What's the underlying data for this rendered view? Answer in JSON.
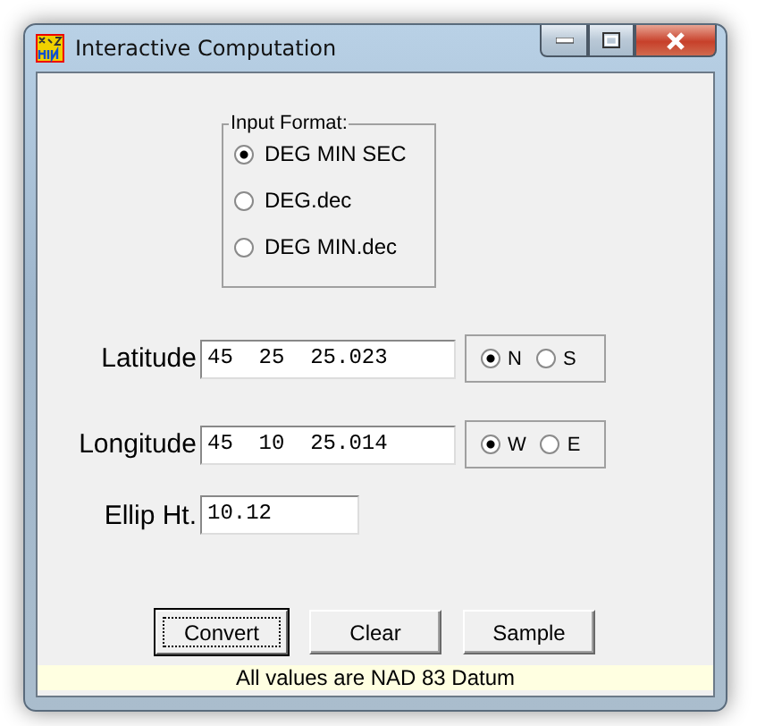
{
  "window": {
    "title": "Interactive Computation"
  },
  "input_format": {
    "label": "Input Format:",
    "options": [
      {
        "label": "DEG MIN SEC",
        "selected": true
      },
      {
        "label": "DEG.dec",
        "selected": false
      },
      {
        "label": "DEG MIN.dec",
        "selected": false
      }
    ]
  },
  "fields": [
    {
      "label": "Latitude",
      "value": "45  25  25.023",
      "hemisphere": [
        {
          "label": "N",
          "selected": true
        },
        {
          "label": "S",
          "selected": false
        }
      ]
    },
    {
      "label": "Longitude",
      "value": "45  10  25.014",
      "hemisphere": [
        {
          "label": "W",
          "selected": true
        },
        {
          "label": "E",
          "selected": false
        }
      ]
    },
    {
      "label": "Ellip Ht.",
      "value": "10.12"
    }
  ],
  "buttons": [
    {
      "label": "Convert",
      "focused": true
    },
    {
      "label": "Clear",
      "focused": false
    },
    {
      "label": "Sample",
      "focused": false
    }
  ],
  "status_bar": "All values are NAD 83 Datum"
}
